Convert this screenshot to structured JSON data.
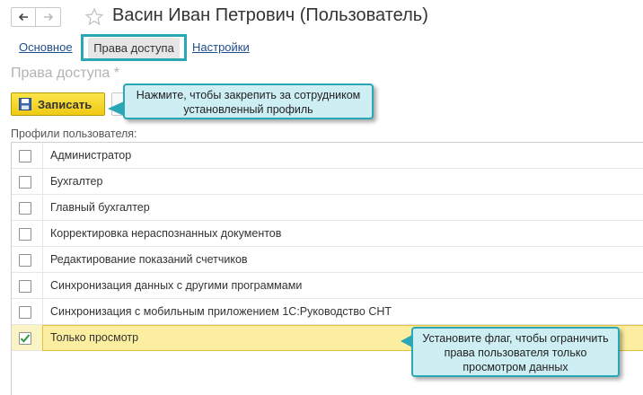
{
  "window": {
    "title": "Васин Иван Петрович (Пользователь)",
    "back_icon": "arrow-left-icon",
    "forward_icon": "arrow-right-icon",
    "favorite_icon": "star-icon"
  },
  "tabs": [
    {
      "label": "Основное",
      "active": false
    },
    {
      "label": "Права доступа",
      "active": true
    },
    {
      "label": "Настройки",
      "active": false
    }
  ],
  "section": {
    "title": "Права доступа *"
  },
  "toolbar": {
    "save_label": "Записать",
    "save_icon": "floppy-disk-icon"
  },
  "callouts": {
    "save_hint": "Нажмите, чтобы закрепить за сотрудником установленный профиль",
    "flag_hint": "Установите флаг, чтобы ограничить права пользователя только просмотром данных"
  },
  "profiles": {
    "label": "Профили пользователя:",
    "items": [
      {
        "label": "Администратор",
        "checked": false
      },
      {
        "label": "Бухгалтер",
        "checked": false
      },
      {
        "label": "Главный бухгалтер",
        "checked": false
      },
      {
        "label": "Корректировка нераспознанных документов",
        "checked": false
      },
      {
        "label": "Редактирование показаний счетчиков",
        "checked": false
      },
      {
        "label": "Синхронизация данных с другими программами",
        "checked": false
      },
      {
        "label": "Синхронизация с мобильным приложением 1С:Руководство СНТ",
        "checked": false
      },
      {
        "label": "Только просмотр",
        "checked": true
      }
    ]
  },
  "colors": {
    "accent": "#2aa7b4",
    "save_button": "#f5d321",
    "selected_row": "#fbeea0",
    "link": "#1f4e8c"
  }
}
